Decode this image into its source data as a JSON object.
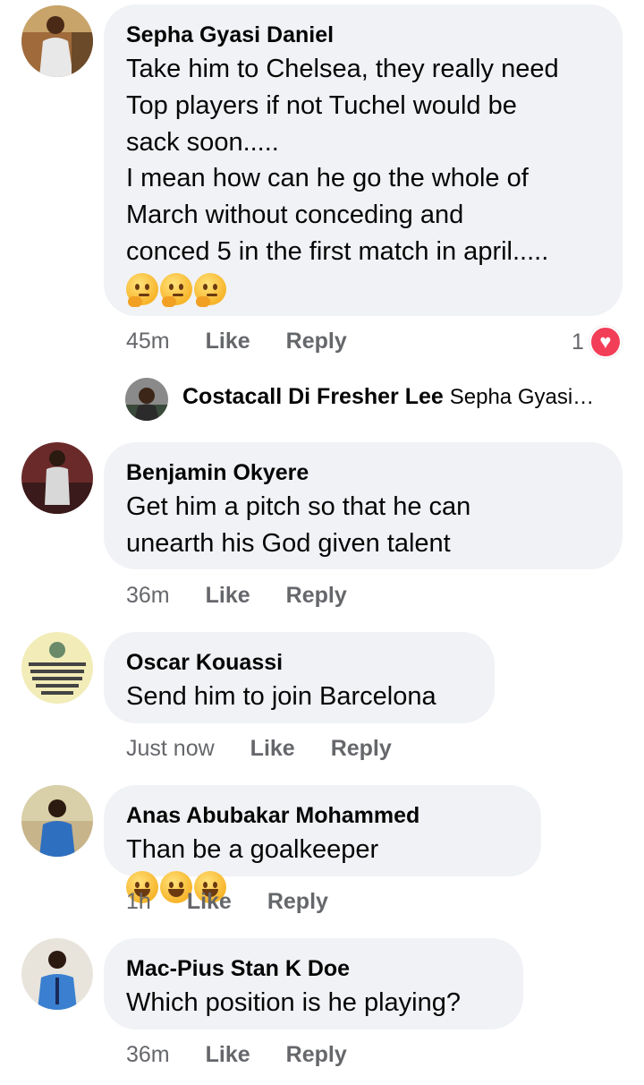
{
  "comments": [
    {
      "author": "Sepha Gyasi Daniel",
      "text": "Take him to Chelsea, they really need\nTop players if not Tuchel would be\nsack soon.....\n I mean how can he go the whole of\nMarch without conceding and\nconced 5 in the first match in april.....",
      "emojis": [
        "thinking-face",
        "thinking-face",
        "thinking-face"
      ],
      "time": "45m",
      "like": "Like",
      "reply": "Reply",
      "reaction_count": "1",
      "reaction_icon": "heart-icon"
    },
    {
      "author": "Benjamin Okyere",
      "text": "Get him a pitch so that he can\nunearth his God given talent",
      "time": "36m",
      "like": "Like",
      "reply": "Reply"
    },
    {
      "author": "Oscar Kouassi",
      "text": "Send him to join Barcelona",
      "time": "Just now",
      "like": "Like",
      "reply": "Reply"
    },
    {
      "author": "Anas Abubakar Mohammed",
      "text": "Than be a goalkeeper",
      "emojis": [
        "rolling-laughing-face",
        "tears-of-joy-face",
        "rolling-laughing-face"
      ],
      "time": "1h",
      "like": "Like",
      "reply": "Reply"
    },
    {
      "author": "Mac-Pius Stan K Doe",
      "text": "Which position is he playing?",
      "time": "36m",
      "like": "Like",
      "reply": "Reply"
    }
  ],
  "reply_preview": {
    "author": "Costacall Di Fresher Lee",
    "snippet": "Sepha Gyasi…"
  },
  "colors": {
    "bubble_bg": "#f0f2f5",
    "meta_text": "#65676b",
    "heart": "#f33e58"
  }
}
